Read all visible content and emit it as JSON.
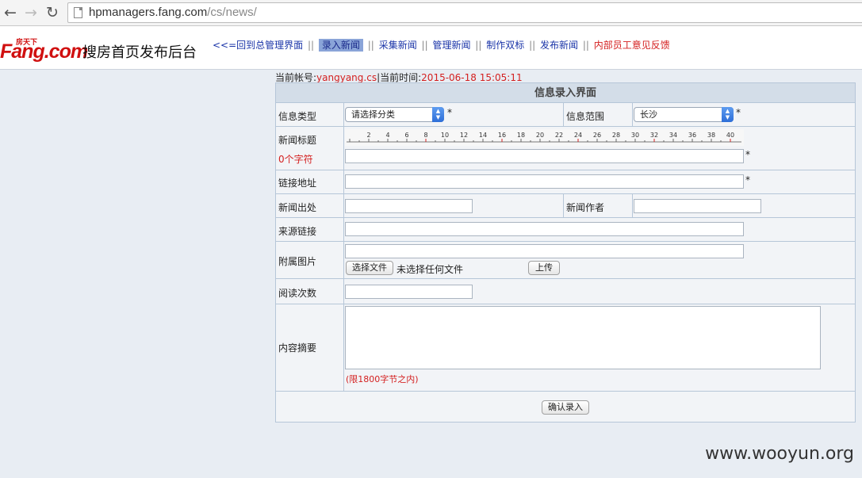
{
  "browser": {
    "back_icon": "arrow-left-icon",
    "forward_icon": "arrow-right-icon",
    "reload_icon": "reload-icon",
    "url_host": "hpmanagers.fang.com",
    "url_path": "/cs/news/"
  },
  "header": {
    "logo_small": "房天下",
    "logo_main": "Fang.com",
    "site_title": "搜房首页发布后台",
    "nav": [
      {
        "label": "<<=回到总管理界面",
        "style": "normal"
      },
      {
        "label": "录入新闻",
        "style": "active"
      },
      {
        "label": "采集新闻",
        "style": "normal"
      },
      {
        "label": "管理新闻",
        "style": "normal"
      },
      {
        "label": "制作双标",
        "style": "normal"
      },
      {
        "label": "发布新闻",
        "style": "normal"
      },
      {
        "label": "内部员工意见反馈",
        "style": "red"
      }
    ],
    "nav_separator": "||"
  },
  "account": {
    "user_label": "当前帐号:",
    "user_value": "yangyang.cs",
    "sep": "|",
    "time_label": "当前时间:",
    "time_value": "2015-06-18 15:05:11"
  },
  "form": {
    "title": "信息录入界面",
    "type_label": "信息类型",
    "type_value": "请选择分类",
    "scope_label": "信息范围",
    "scope_value": "长沙",
    "required_mark": "*",
    "headline_label": "新闻标题",
    "char_count": "0个字符",
    "ruler_ticks": [
      "2",
      "4",
      "6",
      "8",
      "10",
      "12",
      "14",
      "16",
      "18",
      "20",
      "22",
      "24",
      "26",
      "28",
      "30",
      "32",
      "34",
      "36",
      "38",
      "40"
    ],
    "link_label": "链接地址",
    "origin_label": "新闻出处",
    "author_label": "新闻作者",
    "source_link_label": "来源链接",
    "image_label": "附属图片",
    "choose_file_button": "选择文件",
    "no_file_text": "未选择任何文件",
    "upload_button": "上传",
    "read_count_label": "阅读次数",
    "summary_label": "内容摘要",
    "summary_limit_note": "(限1800字节之内)",
    "submit_button": "确认录入"
  },
  "watermark": "www.wooyun.org"
}
